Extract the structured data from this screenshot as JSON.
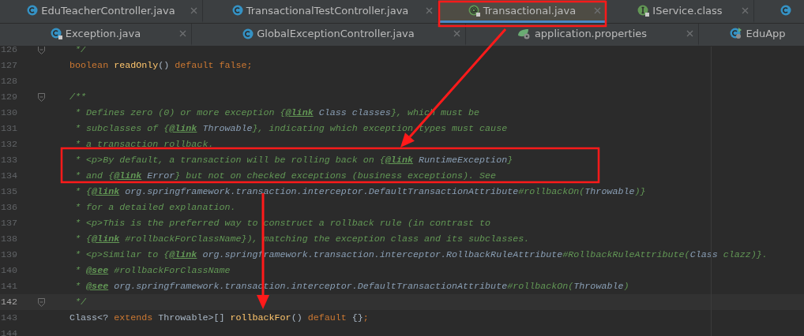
{
  "tab_rows": [
    [
      {
        "label": "EduTeacherController.java",
        "kind": "class",
        "selected": false,
        "closable": true
      },
      {
        "label": "TransactionalTestController.java",
        "kind": "class",
        "selected": false,
        "closable": true
      },
      {
        "label": "Transactional.java",
        "kind": "annotation",
        "selected": true,
        "closable": true
      },
      {
        "label": "IService.class",
        "kind": "interface",
        "selected": false,
        "closable": true
      },
      {
        "kind": "class",
        "selected": false,
        "closable": false
      }
    ],
    [
      {
        "label": "Exception.java",
        "kind": "locked",
        "selected": false,
        "closable": true
      },
      {
        "label": "GlobalExceptionController.java",
        "kind": "class",
        "selected": false,
        "closable": true
      },
      {
        "label": "application.properties",
        "kind": "properties",
        "selected": false,
        "closable": true
      },
      {
        "label": "EduApp",
        "kind": "app",
        "selected": false,
        "closable": false
      }
    ]
  ],
  "editor": {
    "lines": [
      {
        "number": "126",
        "current": false,
        "fold": true,
        "tokens": [
          {
            "kind": "doc",
            "text": "     */"
          }
        ]
      },
      {
        "number": "127",
        "current": false,
        "fold": false,
        "tokens": [
          {
            "kind": "keyword",
            "text": "    boolean "
          },
          {
            "kind": "method",
            "text": "readOnly"
          },
          {
            "kind": "plain",
            "text": "() "
          },
          {
            "kind": "keyword",
            "text": "default false;"
          }
        ]
      },
      {
        "number": "128",
        "current": false,
        "fold": false
      },
      {
        "number": "129",
        "current": false,
        "fold": true,
        "tokens": [
          {
            "kind": "doc",
            "text": "    /**"
          }
        ]
      },
      {
        "number": "130",
        "current": false,
        "fold": false,
        "tokens": [
          {
            "kind": "doc",
            "text": "     * Defines zero (0) or more exception {"
          },
          {
            "kind": "tag",
            "text": "@link"
          },
          {
            "kind": "ref",
            "text": " Class classes"
          },
          {
            "kind": "doc",
            "text": "}, which must be"
          }
        ]
      },
      {
        "number": "131",
        "current": false,
        "fold": false,
        "tokens": [
          {
            "kind": "doc",
            "text": "     * subclasses of {"
          },
          {
            "kind": "tag",
            "text": "@link"
          },
          {
            "kind": "ref",
            "text": " Throwable"
          },
          {
            "kind": "doc",
            "text": "}, indicating which exception types must cause"
          }
        ]
      },
      {
        "number": "132",
        "current": false,
        "fold": false,
        "tokens": [
          {
            "kind": "doc",
            "text": "     * a transaction rollback."
          }
        ]
      },
      {
        "number": "133",
        "current": false,
        "fold": false,
        "tokens": [
          {
            "kind": "doc",
            "text": "     * <p>By default, a transaction will be rolling back on {"
          },
          {
            "kind": "tag",
            "text": "@link"
          },
          {
            "kind": "ref",
            "text": " RuntimeException"
          },
          {
            "kind": "doc",
            "text": "}"
          }
        ]
      },
      {
        "number": "134",
        "current": false,
        "fold": false,
        "tokens": [
          {
            "kind": "doc",
            "text": "     * and {"
          },
          {
            "kind": "tag",
            "text": "@link"
          },
          {
            "kind": "ref",
            "text": " Error"
          },
          {
            "kind": "doc",
            "text": "} but not on checked exceptions (business exceptions). See"
          }
        ]
      },
      {
        "number": "135",
        "current": false,
        "fold": false,
        "tokens": [
          {
            "kind": "doc",
            "text": "     * {"
          },
          {
            "kind": "tag",
            "text": "@link"
          },
          {
            "kind": "ref",
            "text": " org.springframework.transaction.interceptor.DefaultTransactionAttribute"
          },
          {
            "kind": "doc",
            "text": "#rollbackOn("
          },
          {
            "kind": "ref",
            "text": "Throwable"
          },
          {
            "kind": "doc",
            "text": ")}"
          }
        ]
      },
      {
        "number": "136",
        "current": false,
        "fold": false,
        "tokens": [
          {
            "kind": "doc",
            "text": "     * for a detailed explanation."
          }
        ]
      },
      {
        "number": "137",
        "current": false,
        "fold": false,
        "tokens": [
          {
            "kind": "doc",
            "text": "     * <p>This is the preferred way to construct a rollback rule (in contrast to"
          }
        ]
      },
      {
        "number": "138",
        "current": false,
        "fold": false,
        "tokens": [
          {
            "kind": "doc",
            "text": "     * {"
          },
          {
            "kind": "tag",
            "text": "@link"
          },
          {
            "kind": "doc",
            "text": " #rollbackForClassName}), matching the exception class and its subclasses."
          }
        ]
      },
      {
        "number": "139",
        "current": false,
        "fold": false,
        "tokens": [
          {
            "kind": "doc",
            "text": "     * <p>Similar to {"
          },
          {
            "kind": "tag",
            "text": "@link"
          },
          {
            "kind": "ref",
            "text": " org.springframework.transaction.interceptor.RollbackRuleAttribute"
          },
          {
            "kind": "doc",
            "text": "#RollbackRuleAttribute("
          },
          {
            "kind": "ref",
            "text": "Class"
          },
          {
            "kind": "doc",
            "text": " clazz)}."
          }
        ]
      },
      {
        "number": "140",
        "current": false,
        "fold": false,
        "tokens": [
          {
            "kind": "doc",
            "text": "     * "
          },
          {
            "kind": "tag",
            "text": "@see"
          },
          {
            "kind": "doc",
            "text": " #rollbackForClassName"
          }
        ]
      },
      {
        "number": "141",
        "current": false,
        "fold": false,
        "tokens": [
          {
            "kind": "doc",
            "text": "     * "
          },
          {
            "kind": "tag",
            "text": "@see"
          },
          {
            "kind": "ref",
            "text": " org.springframework.transaction.interceptor.DefaultTransactionAttribute"
          },
          {
            "kind": "doc",
            "text": "#rollbackOn("
          },
          {
            "kind": "ref",
            "text": "Throwable"
          },
          {
            "kind": "doc",
            "text": ")"
          }
        ]
      },
      {
        "number": "142",
        "current": true,
        "fold": true,
        "tokens": [
          {
            "kind": "doc",
            "text": "     */"
          }
        ]
      },
      {
        "number": "143",
        "current": false,
        "fold": false,
        "tokens": [
          {
            "kind": "plain",
            "text": "    Class<? "
          },
          {
            "kind": "keyword",
            "text": "extends"
          },
          {
            "kind": "plain",
            "text": " Throwable>[] "
          },
          {
            "kind": "method",
            "text": "rollbackFor"
          },
          {
            "kind": "plain",
            "text": "() "
          },
          {
            "kind": "keyword",
            "text": "default"
          },
          {
            "kind": "plain",
            "text": " {}"
          },
          {
            "kind": "keyword",
            "text": ";"
          }
        ]
      },
      {
        "number": "144",
        "current": false,
        "fold": false
      }
    ]
  },
  "annotations": [
    {
      "kind": "box"
    },
    {
      "kind": "box"
    },
    {
      "kind": "arrow"
    },
    {
      "kind": "arrow"
    }
  ]
}
